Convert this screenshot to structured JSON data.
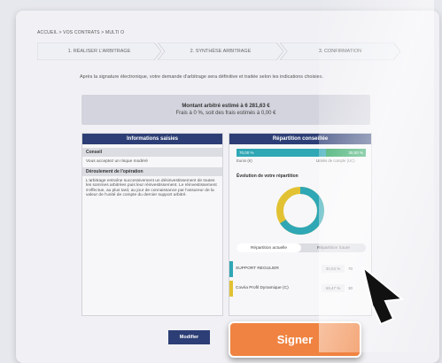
{
  "breadcrumb": "ACCUEIL > VOS CONTRATS > MULTI O",
  "steps": [
    {
      "label": "1. RÉALISER L'ARBITRAGE"
    },
    {
      "label": "2. SYNTHÈSE ARBITRAGE"
    },
    {
      "label": "3. CONFIRMATION"
    }
  ],
  "intro": "Après la signature électronique, votre demande d'arbitrage sera définitive et traitée selon les indications choisies.",
  "estimate": {
    "line1": "Montant arbitré estimé à 6 281,63 €",
    "line2": "Frais à 0 %, soit des frais estimés à 0,00 €"
  },
  "left_card": {
    "title": "Informations saisies",
    "section1_title": "Conseil",
    "section1_text": "Vous acceptez un risque modéré",
    "section2_title": "Déroulement de l'opération",
    "section2_text": "L'arbitrage entraîne successivement un désinvestissement de toutes les sommes arbitrées puis leur réinvestissement. Le réinvestissement s'effectue, au plus tard, au jour de connaissance par l'assureur de la valeur de l'unité de compte du dernier support arbitré."
  },
  "right_card": {
    "title": "Répartition conseillée",
    "bar_left_pct": "70,00 %",
    "bar_right_pct": "30,00 %",
    "bar_split": 0.7,
    "label_euros": "Euros (€)",
    "label_uc": "Unités de compte (UC)",
    "evolution_title": "Évolution de votre répartition",
    "donut": {
      "teal_fraction": 0.66,
      "yellow_fraction": 0.34
    },
    "toggle": {
      "current": "Répartition actuelle",
      "future": "Répartition future"
    },
    "rows": [
      {
        "name": "SUPPORT REGULIER",
        "pct": "30,53 %",
        "pct2": "70",
        "color": "#2fa7b5"
      },
      {
        "name": "Covéa Profil Dynamique (C)",
        "pct": "69,47 %",
        "pct2": "30",
        "color": "#e2c233"
      }
    ]
  },
  "buttons": {
    "modifier": "Modifier",
    "signer": "Signer"
  },
  "colors": {
    "navy": "#2c3e75",
    "orange": "#f08341",
    "teal": "#2fa7b5",
    "green": "#1c9f55",
    "yellow": "#e2c233"
  }
}
